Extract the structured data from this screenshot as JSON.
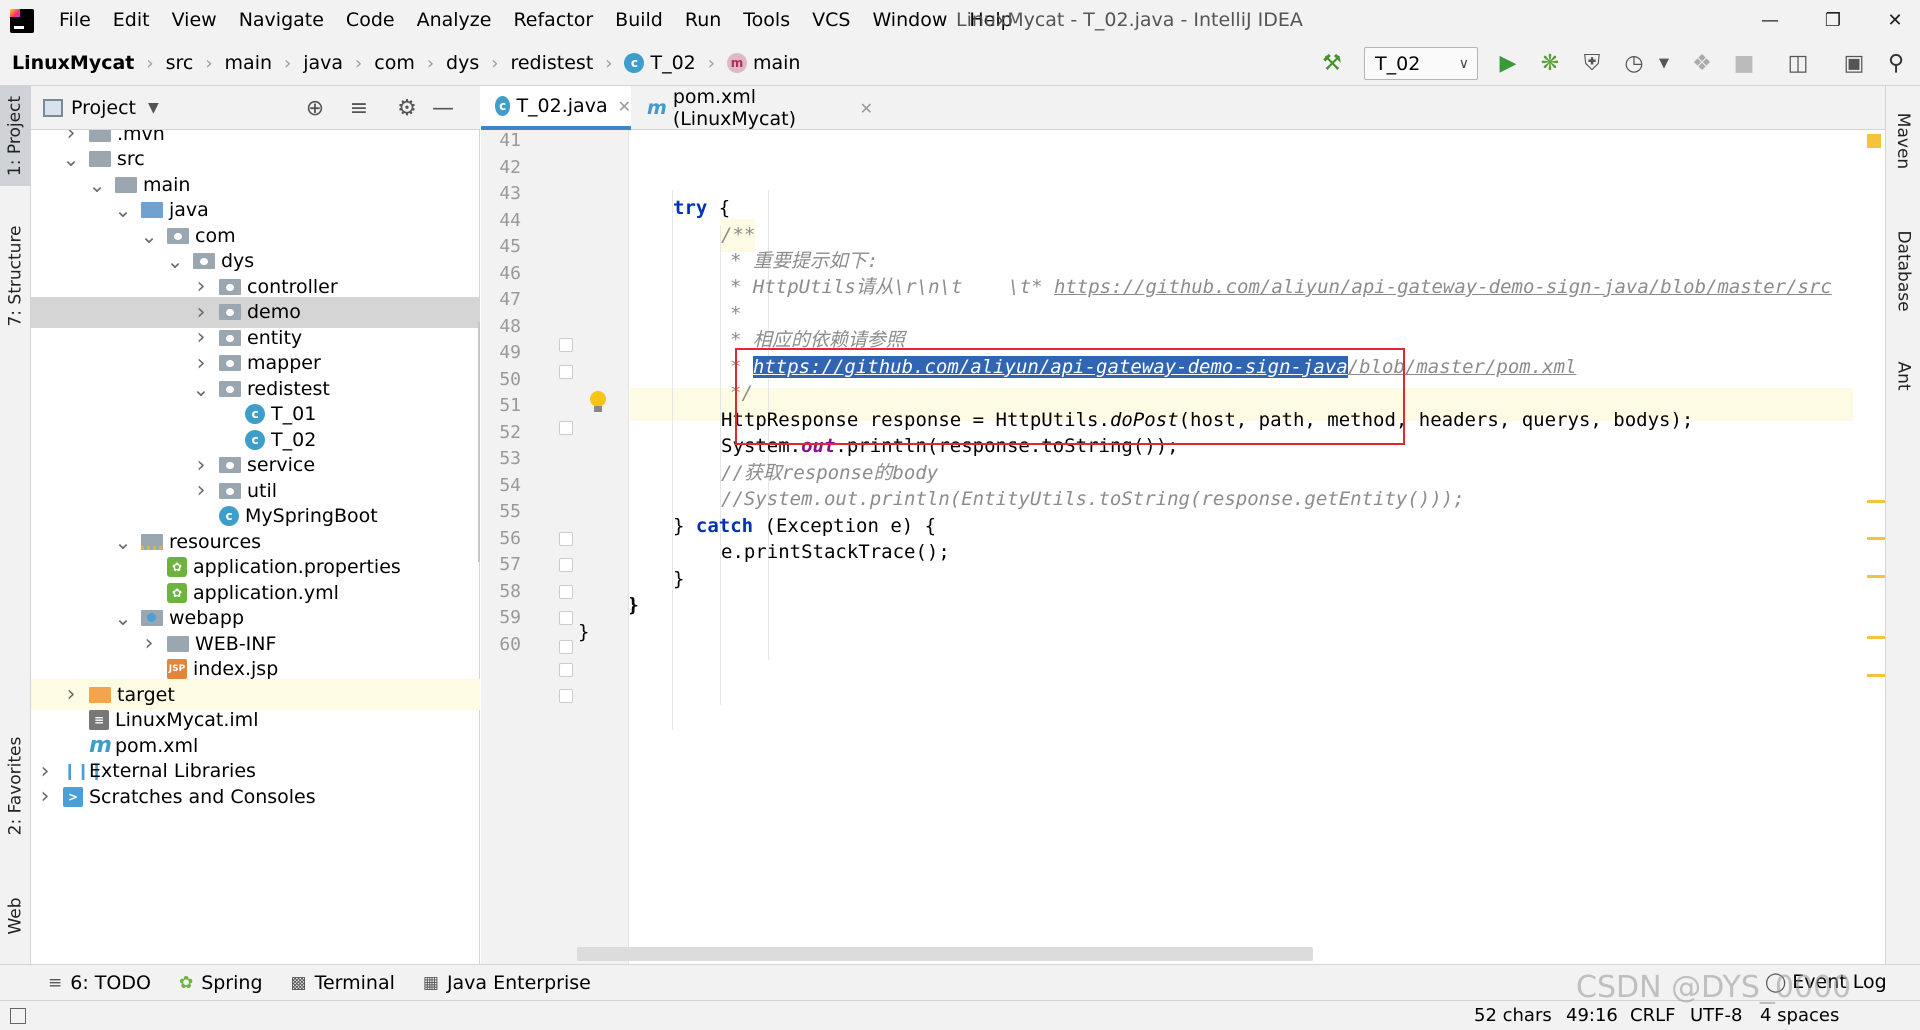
{
  "window": {
    "title": "LinuxMycat - T_02.java - IntelliJ IDEA"
  },
  "menu": [
    "File",
    "Edit",
    "View",
    "Navigate",
    "Code",
    "Analyze",
    "Refactor",
    "Build",
    "Run",
    "Tools",
    "VCS",
    "Window",
    "Help"
  ],
  "breadcrumb": [
    "LinuxMycat",
    "src",
    "main",
    "java",
    "com",
    "dys",
    "redistest",
    "T_02",
    "main"
  ],
  "run_config": "T_02",
  "left_tabs": {
    "project": "1: Project",
    "structure": "7: Structure",
    "favorites": "2: Favorites",
    "web": "Web"
  },
  "right_tabs": {
    "maven": "Maven",
    "database": "Database",
    "ant": "Ant"
  },
  "project_panel": {
    "title": "Project",
    "tree": [
      {
        "label": ".mvn",
        "depth": 2,
        "arrow": "right",
        "icon": "folder"
      },
      {
        "label": "src",
        "depth": 2,
        "arrow": "down",
        "icon": "folder"
      },
      {
        "label": "main",
        "depth": 3,
        "arrow": "down",
        "icon": "folder"
      },
      {
        "label": "java",
        "depth": 4,
        "arrow": "down",
        "icon": "folder-src"
      },
      {
        "label": "com",
        "depth": 5,
        "arrow": "down",
        "icon": "folder-pkg"
      },
      {
        "label": "dys",
        "depth": 6,
        "arrow": "down",
        "icon": "folder-pkg"
      },
      {
        "label": "controller",
        "depth": 7,
        "arrow": "right",
        "icon": "folder-pkg"
      },
      {
        "label": "demo",
        "depth": 7,
        "arrow": "right",
        "icon": "folder-pkg",
        "selected": true
      },
      {
        "label": "entity",
        "depth": 7,
        "arrow": "right",
        "icon": "folder-pkg"
      },
      {
        "label": "mapper",
        "depth": 7,
        "arrow": "right",
        "icon": "folder-pkg"
      },
      {
        "label": "redistest",
        "depth": 7,
        "arrow": "down",
        "icon": "folder-pkg"
      },
      {
        "label": "T_01",
        "depth": 8,
        "arrow": "",
        "icon": "class"
      },
      {
        "label": "T_02",
        "depth": 8,
        "arrow": "",
        "icon": "class"
      },
      {
        "label": "service",
        "depth": 7,
        "arrow": "right",
        "icon": "folder-pkg"
      },
      {
        "label": "util",
        "depth": 7,
        "arrow": "right",
        "icon": "folder-pkg"
      },
      {
        "label": "MySpringBoot",
        "depth": 7,
        "arrow": "",
        "icon": "class"
      },
      {
        "label": "resources",
        "depth": 4,
        "arrow": "down",
        "icon": "folder-res"
      },
      {
        "label": "application.properties",
        "depth": 5,
        "arrow": "",
        "icon": "spring"
      },
      {
        "label": "application.yml",
        "depth": 5,
        "arrow": "",
        "icon": "spring"
      },
      {
        "label": "webapp",
        "depth": 4,
        "arrow": "down",
        "icon": "folder-web"
      },
      {
        "label": "WEB-INF",
        "depth": 5,
        "arrow": "right",
        "icon": "folder"
      },
      {
        "label": "index.jsp",
        "depth": 5,
        "arrow": "",
        "icon": "jsp"
      },
      {
        "label": "target",
        "depth": 2,
        "arrow": "right",
        "icon": "folder-orange",
        "excluded": true
      },
      {
        "label": "LinuxMycat.iml",
        "depth": 2,
        "arrow": "",
        "icon": "iml"
      },
      {
        "label": "pom.xml",
        "depth": 2,
        "arrow": "",
        "icon": "maven"
      },
      {
        "label": "External Libraries",
        "depth": 1,
        "arrow": "right",
        "icon": "lib"
      },
      {
        "label": "Scratches and Consoles",
        "depth": 1,
        "arrow": "right",
        "icon": "scratch"
      }
    ]
  },
  "editor": {
    "tabs": [
      {
        "label": "T_02.java",
        "active": true
      },
      {
        "label": "pom.xml (LinuxMycat)",
        "active": false
      }
    ],
    "line_numbers": [
      "41",
      "42",
      "43",
      "44",
      "45",
      "46",
      "47",
      "48",
      "49",
      "50",
      "51",
      "52",
      "53",
      "54",
      "55",
      "56",
      "57",
      "58",
      "59",
      "60"
    ],
    "code": {
      "l43_try": "try",
      "l43_brace": " {",
      "l44": "/**",
      "l45": "* 重要提示如下:",
      "l46_a": "* HttpUtils请从\\r\\n\\t    \\t* ",
      "l46_url": "https://github.com/aliyun/api-gateway-demo-sign-java/blob/master/src",
      "l47": "*",
      "l48": "* 相应的依赖请参照",
      "l49_star": "* ",
      "l49_sel": "https://github.com/aliyun/api-gateway-demo-sign-java",
      "l49_rest": "/blob/master/pom.xml",
      "l50": "*/",
      "l51_a": "HttpResponse response = HttpUtils.",
      "l51_m": "doPost",
      "l51_b": "(host, path, method, headers, querys, bodys);",
      "l52_a": "System.",
      "l52_out": "out",
      "l52_b": ".println(response.toString());",
      "l53": "//获取response的body",
      "l54": "//System.out.println(EntityUtils.toString(response.getEntity()));",
      "l55_a": "} ",
      "l55_kw": "catch",
      "l55_b": " (Exception e) {",
      "l56": "e.printStackTrace();",
      "l57": "}",
      "l58": "}",
      "l59": "}"
    }
  },
  "bottom_tabs": [
    "6: TODO",
    "Spring",
    "Terminal",
    "Java Enterprise"
  ],
  "event_log": "Event Log",
  "status": {
    "chars": "52 chars",
    "position": "49:16",
    "line_sep": "CRLF",
    "encoding": "UTF-8",
    "indent": "4 spaces"
  },
  "watermark": "CSDN @DYS_0000"
}
